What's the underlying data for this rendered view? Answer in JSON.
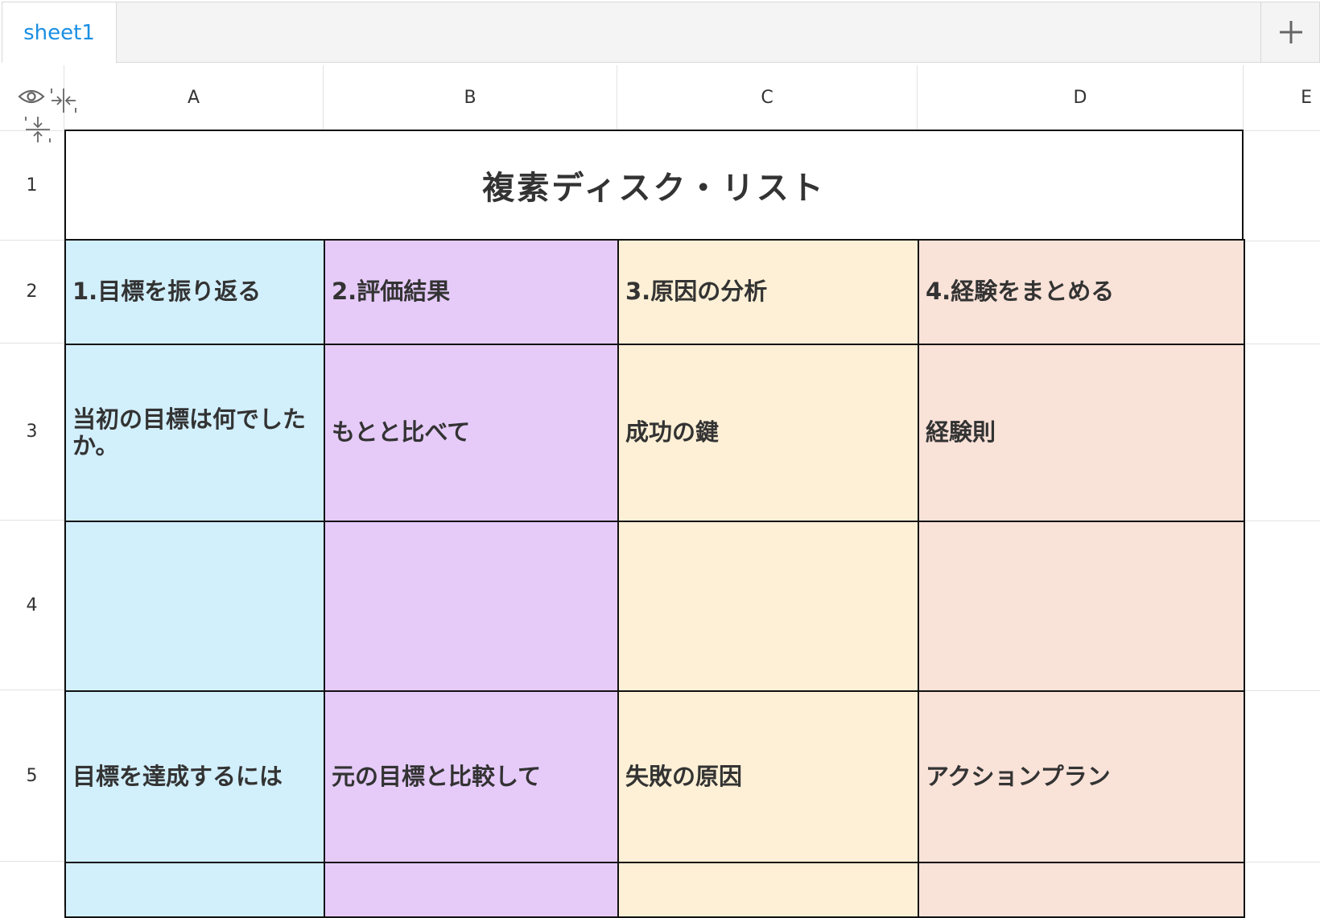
{
  "tabs": {
    "sheet1": "sheet1"
  },
  "columns": [
    "A",
    "B",
    "C",
    "D",
    "E"
  ],
  "rows": [
    "1",
    "2",
    "3",
    "4",
    "5"
  ],
  "title": "複素ディスク・リスト",
  "headers": [
    "1.目標を振り返る",
    "2.評価結果",
    "3.原因の分析",
    "4.経験をまとめる"
  ],
  "row3": [
    "当初の目標は何でしたか。",
    "もとと比べて",
    "成功の鍵",
    "経験則"
  ],
  "row4": [
    "",
    "",
    "",
    ""
  ],
  "row5": [
    "目標を達成するには",
    "元の目標と比較して",
    "失敗の原因",
    "アクションプラン"
  ],
  "colors": {
    "colA": "#d2effc",
    "colB": "#e6cbf9",
    "colC": "#fdf0d6",
    "colD": "#f9e2d8",
    "tab_active": "#1a8fe3"
  },
  "icons": [
    "add-sheet-icon",
    "eye-icon",
    "collapse-columns-icon",
    "collapse-rows-icon"
  ]
}
